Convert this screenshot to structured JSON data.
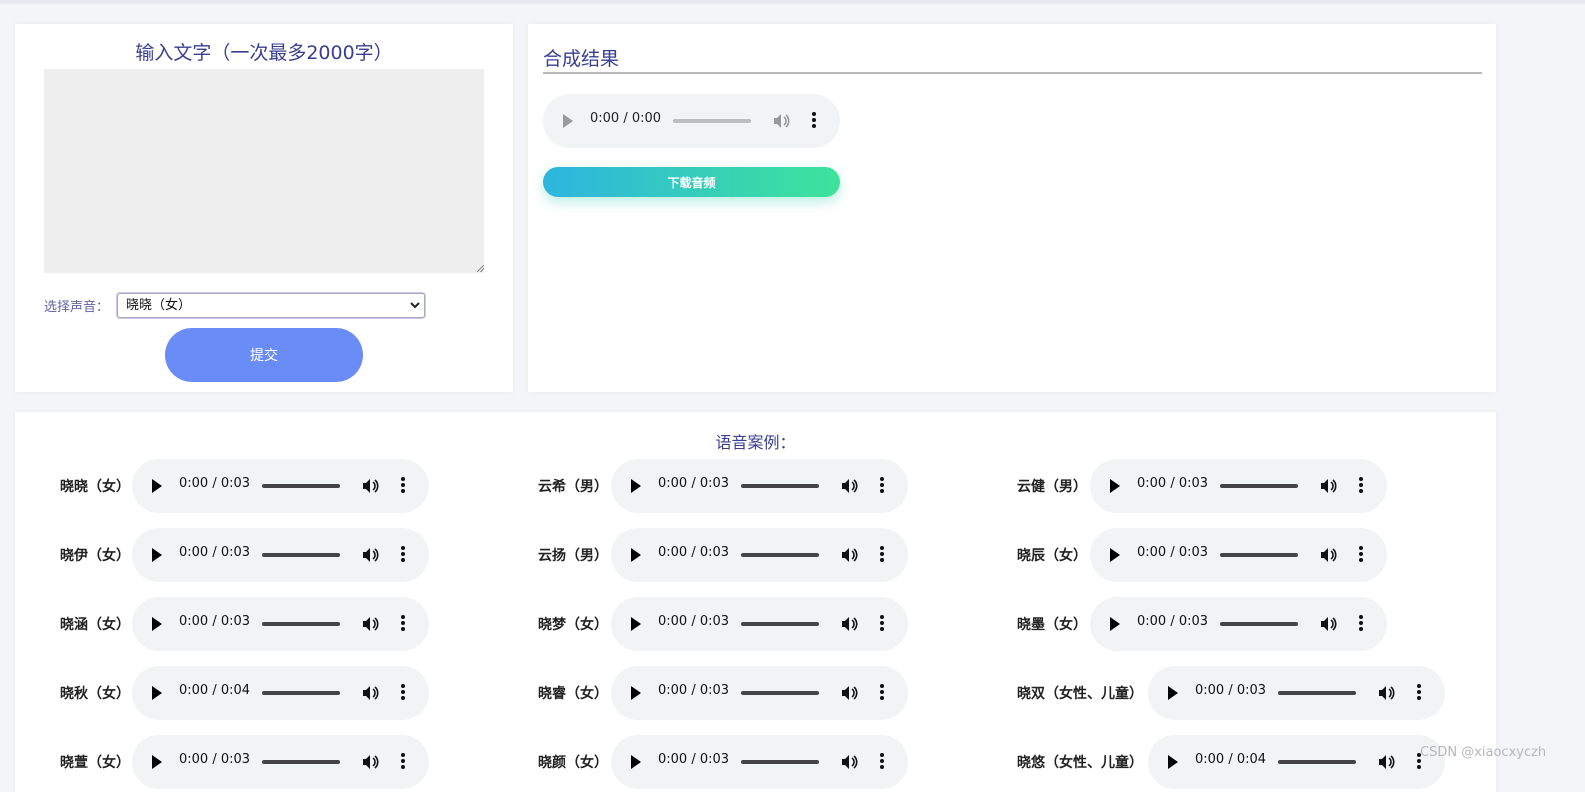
{
  "input_panel": {
    "title": "输入文字（一次最多2000字）",
    "text_value": "",
    "voice_label": "选择声音：",
    "voice_selected": "晓晓（女）",
    "submit_label": "提交"
  },
  "result_panel": {
    "title": "合成结果",
    "player": {
      "time": "0:00 / 0:00"
    },
    "download_label": "下载音频"
  },
  "samples": {
    "title": "语音案例：",
    "items": [
      {
        "label": "晓晓（女）",
        "time": "0:00 / 0:03"
      },
      {
        "label": "云希（男）",
        "time": "0:00 / 0:03"
      },
      {
        "label": "云健（男）",
        "time": "0:00 / 0:03"
      },
      {
        "label": "晓伊（女）",
        "time": "0:00 / 0:03"
      },
      {
        "label": "云扬（男）",
        "time": "0:00 / 0:03"
      },
      {
        "label": "晓辰（女）",
        "time": "0:00 / 0:03"
      },
      {
        "label": "晓涵（女）",
        "time": "0:00 / 0:03"
      },
      {
        "label": "晓梦（女）",
        "time": "0:00 / 0:03"
      },
      {
        "label": "晓墨（女）",
        "time": "0:00 / 0:03"
      },
      {
        "label": "晓秋（女）",
        "time": "0:00 / 0:04"
      },
      {
        "label": "晓睿（女）",
        "time": "0:00 / 0:03"
      },
      {
        "label": "晓双（女性、儿童）",
        "time": "0:00 / 0:03"
      },
      {
        "label": "晓萱（女）",
        "time": "0:00 / 0:03"
      },
      {
        "label": "晓颜（女）",
        "time": "0:00 / 0:03"
      },
      {
        "label": "晓悠（女性、儿童）",
        "time": "0:00 / 0:04"
      }
    ]
  },
  "watermark": "CSDN @xiaocxyczh",
  "colors": {
    "title": "#3a3f8f",
    "submit": "#6a8cf7",
    "download_start": "#2db5df",
    "download_end": "#3ee39a",
    "player_bg": "#f1f3f4"
  },
  "icons": [
    "play-icon",
    "volume-icon",
    "more-vert-icon",
    "chevron-down-icon"
  ]
}
